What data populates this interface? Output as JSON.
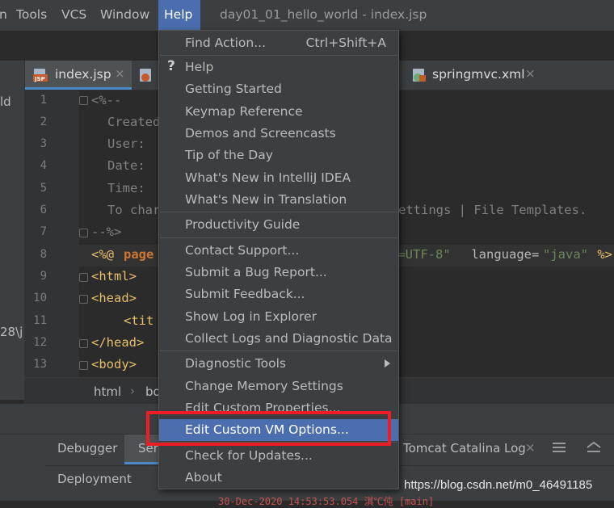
{
  "menubar": {
    "partial_item": "n",
    "items": [
      "Tools",
      "VCS",
      "Window",
      "Help"
    ],
    "title": "day01_01_hello_world - index.jsp"
  },
  "left_strip": {
    "label_top": "ld",
    "label_mid": "28\\j"
  },
  "tabs": [
    {
      "label": "index.jsp",
      "close": "×",
      "icon": "jsp-file-icon",
      "active": true
    },
    {
      "label": "springmvc.xml",
      "close": "×",
      "icon": "xml-file-icon",
      "active": false
    }
  ],
  "editor": {
    "line_numbers": [
      "1",
      "2",
      "3",
      "4",
      "5",
      "6",
      "7",
      "8",
      "9",
      "10",
      "11",
      "12",
      "13"
    ],
    "lines": {
      "l1": "<%--",
      "l2": "Created",
      "l3": "User: ",
      "l4": "Date: ",
      "l5": "Time: ",
      "l6a": "To char",
      "l6b": "ettings | File Templates.",
      "l7": "--%>",
      "l8_open": "<%@ ",
      "l8_kw": "page",
      "l8_attr_val": "t=UTF-8\"",
      "l8_lang_attr": " language=",
      "l8_lang_val": "\"java\"",
      "l8_close": " %>",
      "l9": "<html>",
      "l10": "<head>",
      "l11": "<tit",
      "l12": "</head>",
      "l13": "<body>"
    }
  },
  "breadcrumb": {
    "item1": "html",
    "sep": "›",
    "item2": "bo"
  },
  "bottom_panel": {
    "tab_debugger": "Debugger",
    "tab_server": "Ser",
    "tab_tomcat": "Tomcat Catalina Log",
    "tomcat_close": "×",
    "deployment_label": "Deployment",
    "log_fragment": "30-Dec-2020 14:53:53.054 淇℃伅 [main]"
  },
  "help_menu": {
    "items": [
      {
        "label": "Find Action...",
        "shortcut": "Ctrl+Shift+A"
      },
      {
        "label": "Help"
      },
      {
        "label": "Getting Started"
      },
      {
        "label": "Keymap Reference"
      },
      {
        "label": "Demos and Screencasts"
      },
      {
        "label": "Tip of the Day"
      },
      {
        "label": "What's New in IntelliJ IDEA"
      },
      {
        "label": "What's New in Translation"
      },
      {
        "label": "Productivity Guide"
      },
      {
        "label": "Contact Support..."
      },
      {
        "label": "Submit a Bug Report..."
      },
      {
        "label": "Submit Feedback..."
      },
      {
        "label": "Show Log in Explorer"
      },
      {
        "label": "Collect Logs and Diagnostic Data"
      },
      {
        "label": "Diagnostic Tools"
      },
      {
        "label": "Change Memory Settings"
      },
      {
        "label": "Edit Custom Properties..."
      },
      {
        "label": "Edit Custom VM Options...",
        "selected": true
      },
      {
        "label": "Check for Updates..."
      },
      {
        "label": "About"
      }
    ]
  },
  "watermark": "https://blog.csdn.net/m0_46491185",
  "colors": {
    "menu_selection": "#4b6eaf",
    "annotation_red": "#ee1c25",
    "tag_yellow": "#e8bf6a",
    "keyword_orange": "#cc7832",
    "string_green": "#6a8759",
    "comment_gray": "#808080"
  }
}
